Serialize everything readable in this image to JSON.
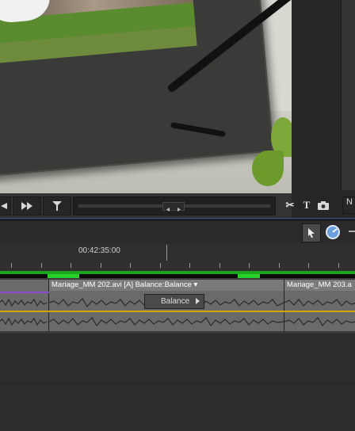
{
  "transport": {
    "buttons": [
      {
        "name": "step-back-button",
        "icon": "step-back-icon"
      },
      {
        "name": "fast-forward-button",
        "icon": "fast-forward-icon"
      },
      {
        "name": "shuttle-button",
        "icon": "shuttle-icon"
      }
    ],
    "tools": [
      {
        "name": "scissors-button",
        "glyph": "✂"
      },
      {
        "name": "title-button",
        "glyph": "T"
      },
      {
        "name": "snapshot-button",
        "glyph": "📷"
      }
    ]
  },
  "timeline": {
    "timecode": "00:42:35:00",
    "clip1_label": "Mariage_MM 202.avi [A]  Balance:Balance ▾",
    "clip2_label": "Mariage_MM 203.a",
    "popup_label": "Balance"
  },
  "colors": {
    "accent_green": "#1aa51a",
    "volume_line": "#d8a200",
    "selection_purple": "#8a4ad2"
  }
}
